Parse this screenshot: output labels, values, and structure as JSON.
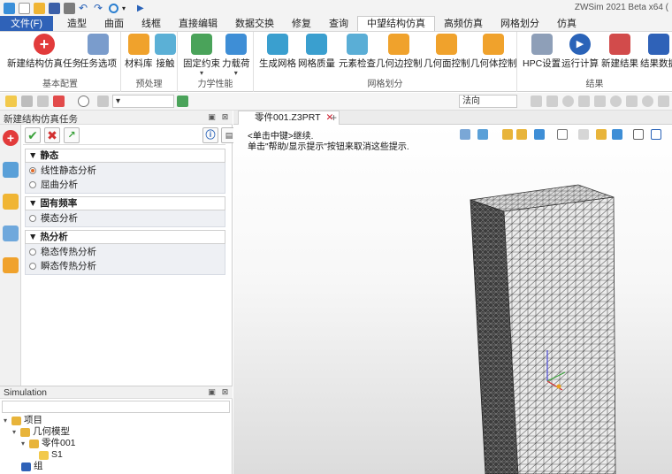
{
  "app": {
    "title": "ZWSim 2021 Beta x64 ("
  },
  "quick_access": [
    "app-logo-icon",
    "new-file-icon",
    "open-file-icon",
    "save-icon",
    "print-icon",
    "undo-icon",
    "redo-icon",
    "snap-icon",
    "dropdown-icon",
    "play-icon"
  ],
  "ribbon": {
    "tabs": [
      {
        "label": "文件(F)",
        "kind": "file"
      },
      {
        "label": "造型"
      },
      {
        "label": "曲面"
      },
      {
        "label": "线框"
      },
      {
        "label": "直接编辑"
      },
      {
        "label": "数据交换"
      },
      {
        "label": "修复"
      },
      {
        "label": "查询"
      },
      {
        "label": "中望结构仿真",
        "active": true
      },
      {
        "label": "高频仿真"
      },
      {
        "label": "网格划分"
      },
      {
        "label": "仿真"
      }
    ],
    "groups": {
      "basic": {
        "label": "基本配置",
        "buttons": [
          "新建结构仿真任务",
          "任务选项"
        ]
      },
      "pre": {
        "label": "预处理",
        "buttons": [
          "材料库",
          "接触"
        ]
      },
      "mech": {
        "label": "力学性能",
        "buttons": [
          "固定约束",
          "力载荷"
        ]
      },
      "mesh": {
        "label": "网格划分",
        "buttons": [
          "生成网格",
          "网格质量",
          "元素检查",
          "几何边控制",
          "几何面控制",
          "几何体控制"
        ]
      },
      "result": {
        "label": "结果",
        "buttons": [
          "HPC设置",
          "运行计算",
          "新建结果",
          "结果数据"
        ]
      }
    }
  },
  "toolbar": {
    "view_combo": "法向"
  },
  "task_panel": {
    "title": "新建结构仿真任务",
    "sections": [
      {
        "label": "静态",
        "options": [
          {
            "label": "线性静态分析",
            "selected": true
          },
          {
            "label": "屈曲分析",
            "selected": false
          }
        ]
      },
      {
        "label": "固有频率",
        "options": [
          {
            "label": "模态分析",
            "selected": false
          }
        ]
      },
      {
        "label": "热分析",
        "options": [
          {
            "label": "稳态传热分析",
            "selected": false
          },
          {
            "label": "瞬态传热分析",
            "selected": false
          }
        ]
      }
    ]
  },
  "simulation": {
    "title": "Simulation",
    "tree": [
      "项目",
      "几何模型",
      "零件001",
      "S1",
      "组"
    ]
  },
  "document": {
    "tab_label": "零件001.Z3PRT",
    "prompt_line1": "<单击中键>继续.",
    "prompt_line2": "单击\"帮助/显示提示\"按钮来取消这些提示."
  },
  "colors": {
    "file_tab": "#2f62b8",
    "accent": "#e06a2a",
    "mesh_line": "#555555"
  }
}
